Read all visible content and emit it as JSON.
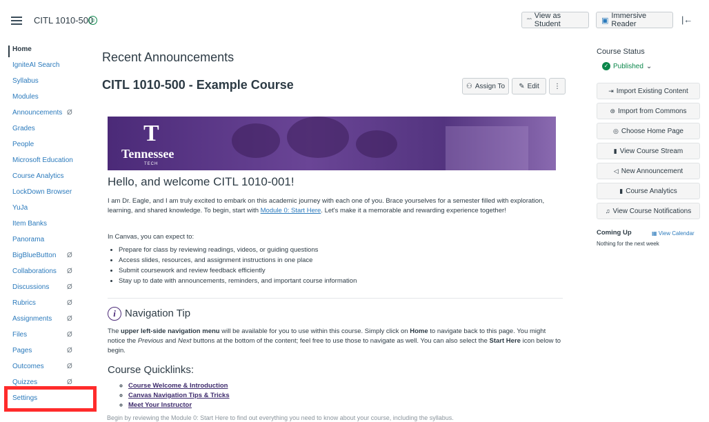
{
  "topbar": {
    "course_code": "CITL 1010-500",
    "view_as_student": "View as Student",
    "immersive_reader": "Immersive Reader"
  },
  "nav": [
    {
      "label": "Home",
      "hidden": false,
      "active": true
    },
    {
      "label": "IgniteAI Search",
      "hidden": false
    },
    {
      "label": "Syllabus",
      "hidden": false
    },
    {
      "label": "Modules",
      "hidden": false
    },
    {
      "label": "Announcements",
      "hidden": true
    },
    {
      "label": "Grades",
      "hidden": false
    },
    {
      "label": "People",
      "hidden": false
    },
    {
      "label": "Microsoft Education",
      "hidden": false
    },
    {
      "label": "Course Analytics",
      "hidden": false
    },
    {
      "label": "LockDown Browser",
      "hidden": false
    },
    {
      "label": "YuJa",
      "hidden": false
    },
    {
      "label": "Item Banks",
      "hidden": false
    },
    {
      "label": "Panorama",
      "hidden": false
    },
    {
      "label": "BigBlueButton",
      "hidden": true
    },
    {
      "label": "Collaborations",
      "hidden": true
    },
    {
      "label": "Discussions",
      "hidden": true
    },
    {
      "label": "Rubrics",
      "hidden": true
    },
    {
      "label": "Assignments",
      "hidden": true
    },
    {
      "label": "Files",
      "hidden": true
    },
    {
      "label": "Pages",
      "hidden": true
    },
    {
      "label": "Outcomes",
      "hidden": true
    },
    {
      "label": "Quizzes",
      "hidden": true
    },
    {
      "label": "Settings",
      "hidden": false
    }
  ],
  "main": {
    "recent_title": "Recent Announcements",
    "page_title": "CITL 1010-500 - Example Course",
    "assign_to": "Assign To",
    "edit": "Edit",
    "banner": {
      "logo_name": "Tennessee",
      "logo_sub": "TECH"
    },
    "welcome_heading": "Hello, and welcome CITL 1010-001!",
    "intro_before": "I am Dr. Eagle, and I am truly excited to embark on this academic journey with each one of you. Brace yourselves for a semester filled with exploration, learning, and shared knowledge. To begin, start with ",
    "intro_link": "Module 0: Start Here",
    "intro_after": ". Let's make it a memorable and rewarding experience together!",
    "expect_text": "In Canvas, you can expect to:",
    "bullets": [
      "Prepare for class by reviewing readings, videos, or guiding questions",
      "Access slides, resources, and assignment instructions in one place",
      "Submit coursework and review feedback efficiently",
      "Stay up to date with announcements, reminders, and important course information"
    ],
    "nav_tip_title": "Navigation Tip",
    "nav_tip": {
      "p1": "The ",
      "b1": "upper left-side navigation menu",
      "p2": " will be available for you to use within this course. Simply click on ",
      "b2": "Home",
      "p3": " to navigate back to this page. You might notice the ",
      "i1": "Previous",
      "p4": " and ",
      "i2": "Next",
      "p5": " buttons at the bottom of the content; feel free to use those to navigate as well. You can also select the ",
      "b3": "Start Here",
      "p6": " icon below to begin."
    },
    "quicklinks_title": "Course Quicklinks:",
    "quicklinks": [
      "Course Welcome & Introduction",
      "Canvas Navigation Tips & Tricks",
      "Meet Your Instructor"
    ],
    "cut_text": "Begin by reviewing the Module 0: Start Here to find out everything you need to know about your course, including the syllabus."
  },
  "sidebar": {
    "status_title": "Course Status",
    "published": "Published",
    "buttons": [
      {
        "label": "Import Existing Content",
        "icon": "import-icon",
        "glyph": "⇥"
      },
      {
        "label": "Import from Commons",
        "icon": "commons-icon",
        "glyph": "⊜"
      },
      {
        "label": "Choose Home Page",
        "icon": "home-target-icon",
        "glyph": "◎"
      },
      {
        "label": "View Course Stream",
        "icon": "bar-chart-icon",
        "glyph": "▮"
      },
      {
        "label": "New Announcement",
        "icon": "megaphone-icon",
        "glyph": "◁"
      },
      {
        "label": "Course Analytics",
        "icon": "analytics-icon",
        "glyph": "▮"
      },
      {
        "label": "View Course Notifications",
        "icon": "bell-icon",
        "glyph": "♫"
      }
    ],
    "coming_up": "Coming Up",
    "view_calendar": "View Calendar",
    "nothing": "Nothing for the next week"
  }
}
